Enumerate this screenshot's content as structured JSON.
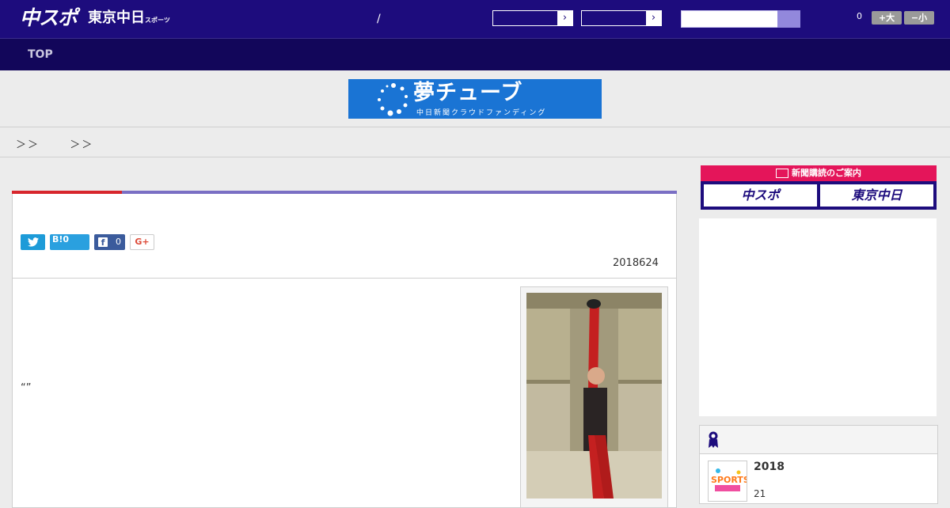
{
  "header": {
    "logo_main": "中スポ",
    "logo_secondary": "東京中日",
    "logo_secondary_small": "スポーツ",
    "separator": "/",
    "dropdown_arrow": "›",
    "count": "0",
    "font_larger": "+大",
    "font_smaller": "−小",
    "colors": {
      "bar": "#1d0c7d",
      "accent": "#9288dc"
    }
  },
  "nav": {
    "items": [
      "TOP"
    ]
  },
  "banner": {
    "title": "夢チューブ",
    "subtitle": "中日新聞クラウドファンディング"
  },
  "breadcrumb": {
    "sep1": "＞＞",
    "sep2": "＞＞"
  },
  "article": {
    "share": {
      "tw_icon": "twitter-icon",
      "hatena": "B!0",
      "fb_count": "0",
      "gplus": "G+"
    },
    "date": "2018624",
    "body_text": "“”"
  },
  "sidebar": {
    "subscribe_heading": "新聞購読のご案内",
    "subscribe_options": [
      "中スポ",
      "東京中日"
    ],
    "ranking": {
      "item_title": "2018",
      "item_sub": "21",
      "thumb_caption": "SPORTS!! 愛演劇"
    }
  }
}
